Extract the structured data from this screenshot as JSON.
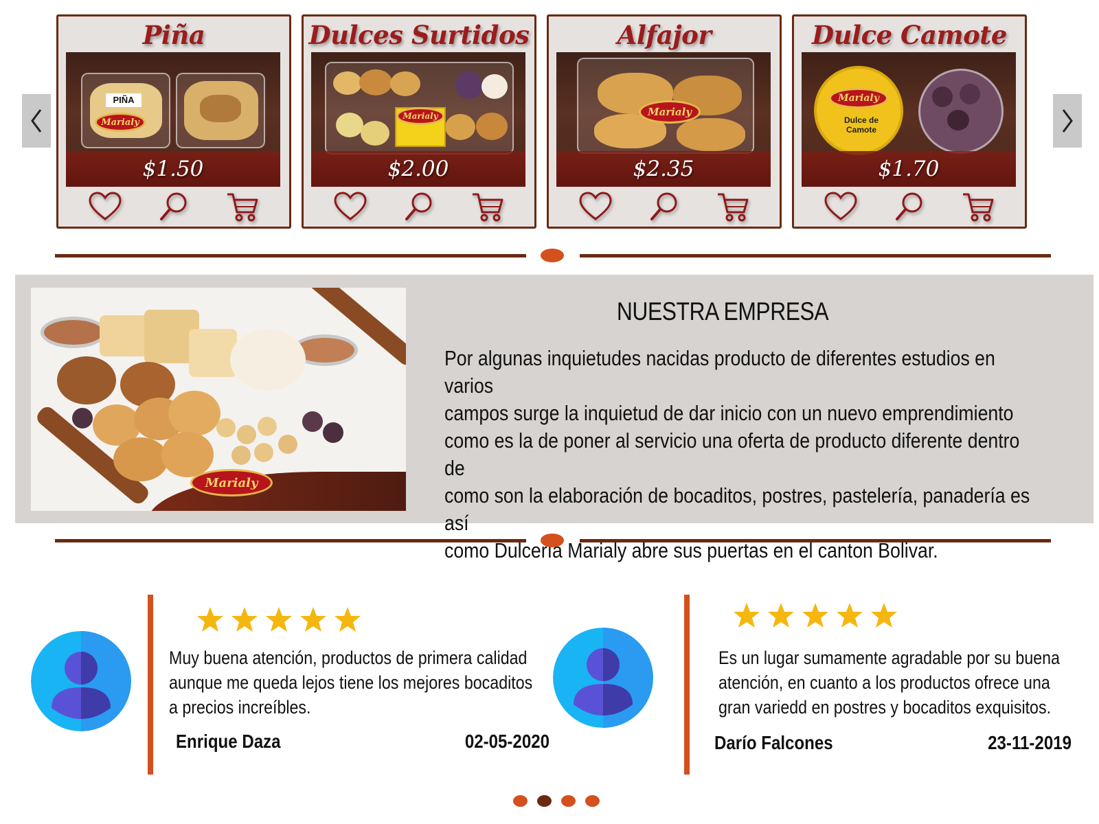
{
  "carousel": {
    "prev_icon": "chevron-left-icon",
    "next_icon": "chevron-right-icon",
    "products": [
      {
        "name": "Piña",
        "price": "$1.50",
        "box_label": "PIÑA",
        "brand": "Marialy"
      },
      {
        "name": "Dulces Surtidos",
        "price": "$2.00",
        "brand": "Marialy"
      },
      {
        "name": "Alfajor",
        "price": "$2.35",
        "brand": "Marialy"
      },
      {
        "name": "Dulce Camote",
        "price": "$1.70",
        "brand": "Marialy",
        "box_label": "Dulce de Camote"
      }
    ],
    "actions": [
      "heart-icon",
      "search-icon",
      "cart-icon"
    ]
  },
  "about": {
    "title": "NUESTRA EMPRESA",
    "text": "Por algunas inquietudes nacidas producto de diferentes estudios en varios\ncampos surge  la inquietud  de dar  inicio con un  nuevo  emprendimiento\ncomo es la de poner al servicio una oferta de producto diferente dentro de\ncomo son la elaboración de bocaditos, postres, pastelería, panadería es así\ncomo Dulcería Marialy abre sus puertas en el canton Bolivar.",
    "image_brand": "Marialy"
  },
  "reviews": [
    {
      "stars": 5,
      "text": "Muy buena atención, productos de primera calidad\naunque me queda lejos tiene los mejores bocaditos\na precios increíbles.",
      "author": "Enrique Daza",
      "date": "02-05-2020"
    },
    {
      "stars": 5,
      "text": "Es un lugar sumamente agradable por su buena\natención, en cuanto a los productos ofrece una\ngran variedd en postres y bocaditos exquisitos.",
      "author": "Darío Falcones",
      "date": "23-11-2019"
    }
  ],
  "pager": {
    "count": 4,
    "active_index": 1
  },
  "colors": {
    "accent": "#d4501e",
    "brown": "#6a2a12",
    "title_red": "#9b1c1c",
    "star": "#f5b70f",
    "avatar_bg": "#29a8f5"
  }
}
